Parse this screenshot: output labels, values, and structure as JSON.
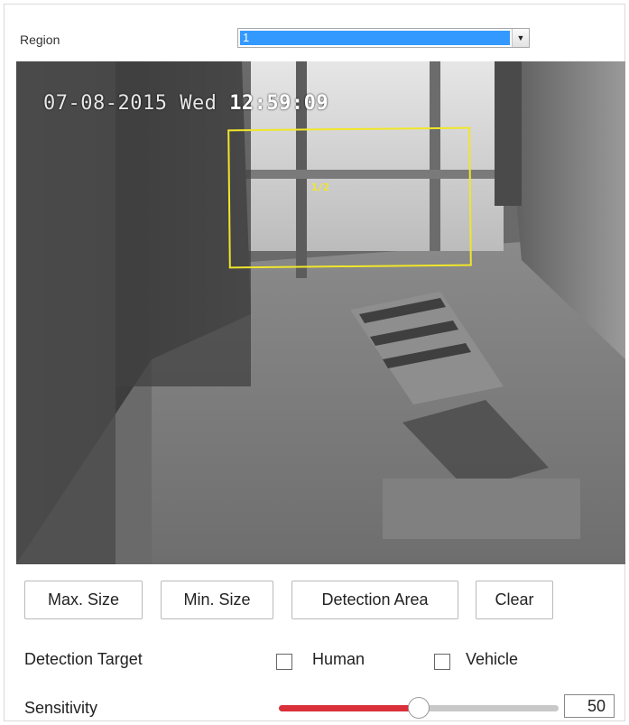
{
  "region": {
    "label": "Region",
    "selected_value": "1",
    "dropdown_icon": "triangle-down"
  },
  "video": {
    "osd_date": "07-08-2015 Wed",
    "osd_time": "12:59:09",
    "region_tag": "1/2",
    "region_color": "#f0e62a",
    "mask_color": "#808080"
  },
  "buttons": {
    "max_size": "Max. Size",
    "min_size": "Min. Size",
    "detection_area": "Detection Area",
    "clear": "Clear"
  },
  "detection_target": {
    "label": "Detection Target",
    "human_label": "Human",
    "human_checked": false,
    "vehicle_label": "Vehicle",
    "vehicle_checked": false
  },
  "sensitivity": {
    "label": "Sensitivity",
    "value": "50",
    "fraction": 0.5,
    "fill_color": "#d9303a"
  }
}
